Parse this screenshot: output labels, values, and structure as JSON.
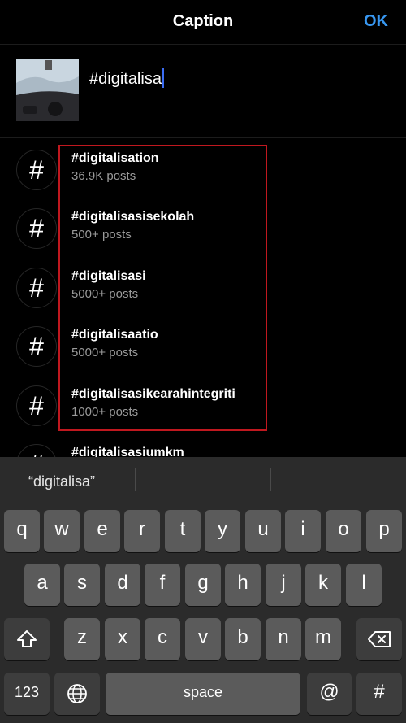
{
  "header": {
    "title": "Caption",
    "ok_label": "OK"
  },
  "compose": {
    "caption_text": "#digitalisa"
  },
  "suggestions": [
    {
      "tag": "#digitalisation",
      "count": "36.9K posts"
    },
    {
      "tag": "#digitalisasisekolah",
      "count": "500+ posts"
    },
    {
      "tag": "#digitalisasi",
      "count": "5000+ posts"
    },
    {
      "tag": "#digitalisaatio",
      "count": "5000+ posts"
    },
    {
      "tag": "#digitalisasikearahintegriti",
      "count": "1000+ posts"
    },
    {
      "tag": "#digitalisasiumkm",
      "count": ""
    }
  ],
  "hash_symbol": "#",
  "keyboard": {
    "predictive": [
      "“digitalisa”",
      "",
      ""
    ],
    "row1": [
      "q",
      "w",
      "e",
      "r",
      "t",
      "y",
      "u",
      "i",
      "o",
      "p"
    ],
    "row2": [
      "a",
      "s",
      "d",
      "f",
      "g",
      "h",
      "j",
      "k",
      "l"
    ],
    "row3": [
      "z",
      "x",
      "c",
      "v",
      "b",
      "n",
      "m"
    ],
    "numbers_label": "123",
    "space_label": "space",
    "at_label": "@",
    "hash_label": "#",
    "shift_icon": "shift-icon",
    "delete_icon": "delete-icon",
    "globe_icon": "globe-icon"
  },
  "colors": {
    "accent": "#3897f0",
    "highlight_box": "#c0181f",
    "caret": "#3b6cf2"
  }
}
